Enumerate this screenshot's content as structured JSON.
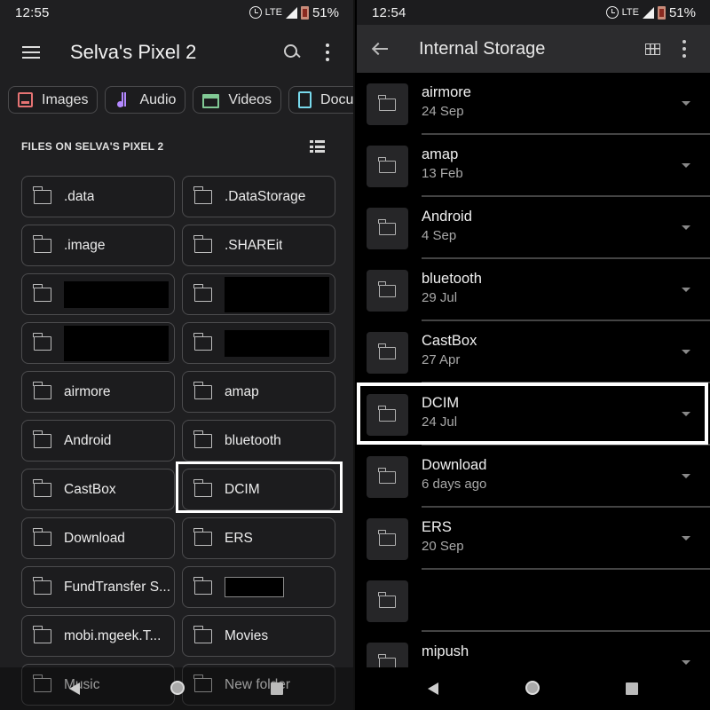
{
  "left": {
    "status": {
      "time": "12:55",
      "network": "LTE",
      "battery": "51%"
    },
    "app_bar": {
      "title": "Selva's Pixel 2",
      "menu_icon": "hamburger-menu-icon",
      "search_icon": "search-icon",
      "more_icon": "more-vert-icon"
    },
    "chips": [
      {
        "label": "Images",
        "icon": "image-icon",
        "color": "#e57373"
      },
      {
        "label": "Audio",
        "icon": "music-note-icon",
        "color": "#b388ff"
      },
      {
        "label": "Videos",
        "icon": "clapperboard-icon",
        "color": "#81c995"
      },
      {
        "label": "Documents",
        "visible_label": "Docu",
        "icon": "document-icon",
        "color": "#78d9ec"
      }
    ],
    "section_title": "FILES ON SELVA'S PIXEL 2",
    "view_toggle_icon": "list-view-icon",
    "folders": [
      {
        "name": ".data"
      },
      {
        "name": ".DataStorage"
      },
      {
        "name": ".image"
      },
      {
        "name": ".SHAREit"
      },
      {
        "name": "",
        "redacted": true
      },
      {
        "name": "",
        "redacted": true
      },
      {
        "name": "",
        "redacted": true
      },
      {
        "name": "",
        "redacted": true
      },
      {
        "name": "airmore"
      },
      {
        "name": "amap"
      },
      {
        "name": "Android"
      },
      {
        "name": "bluetooth"
      },
      {
        "name": "CastBox"
      },
      {
        "name": "DCIM",
        "highlighted": true
      },
      {
        "name": "Download"
      },
      {
        "name": "ERS"
      },
      {
        "name": "FundTransfer S..."
      },
      {
        "name": "",
        "redacted": true
      },
      {
        "name": "mobi.mgeek.T..."
      },
      {
        "name": "Movies"
      },
      {
        "name": "Music"
      },
      {
        "name": "New folder"
      }
    ]
  },
  "right": {
    "status": {
      "time": "12:54",
      "network": "LTE",
      "battery": "51%"
    },
    "app_bar": {
      "title": "Internal Storage",
      "back_icon": "arrow-back-icon",
      "grid_icon": "grid-view-icon",
      "more_icon": "more-vert-icon"
    },
    "rows": [
      {
        "name": "airmore",
        "date": "24 Sep"
      },
      {
        "name": "amap",
        "date": "13 Feb"
      },
      {
        "name": "Android",
        "date": "4 Sep"
      },
      {
        "name": "bluetooth",
        "date": "29 Jul"
      },
      {
        "name": "CastBox",
        "date": "27 Apr"
      },
      {
        "name": "DCIM",
        "date": "24 Jul",
        "highlighted": true
      },
      {
        "name": "Download",
        "date": "6 days ago"
      },
      {
        "name": "ERS",
        "date": "20 Sep"
      },
      {
        "name": "",
        "date": ""
      },
      {
        "name": "mipush",
        "date": ""
      }
    ]
  },
  "nav": {
    "back": "nav-back-icon",
    "home": "nav-home-icon",
    "recents": "nav-recents-icon"
  }
}
